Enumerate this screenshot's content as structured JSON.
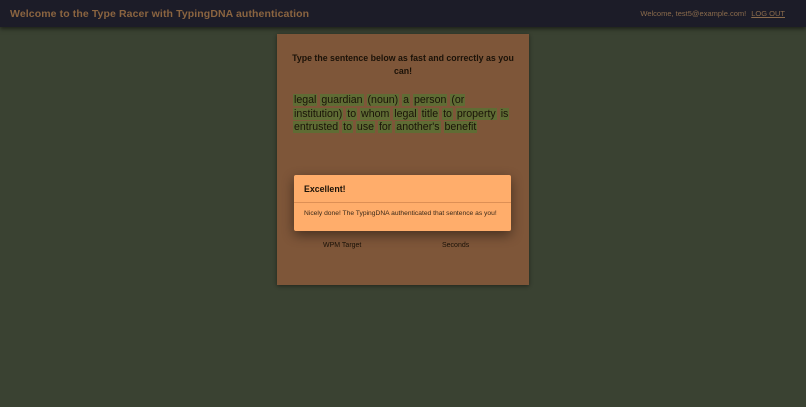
{
  "navbar": {
    "title": "Welcome to the Type Racer with TypingDNA authentication",
    "welcome": "Welcome, test5@example.com!",
    "logout_label": "LOG OUT"
  },
  "card": {
    "instruction": "Type the sentence below as fast and correctly as you can!",
    "sentence_words": [
      "legal",
      "guardian",
      "(noun)",
      "a",
      "person",
      "(or",
      "institution)",
      "to",
      "whom",
      "legal",
      "title",
      "to",
      "property",
      "is",
      "entrusted",
      "to",
      "use",
      "for",
      "another's",
      "benefit"
    ],
    "wpm_label": "WPM Target",
    "seconds_label": "Seconds"
  },
  "modal": {
    "title": "Excellent!",
    "message": "Nicely done! The TypingDNA authenticated that sentence as you!"
  },
  "colors": {
    "background": "#3a4232",
    "navbar": "#1c1c28",
    "card": "#7e5639",
    "word_highlight": "#5f6c34",
    "modal": "#ffad6b"
  }
}
